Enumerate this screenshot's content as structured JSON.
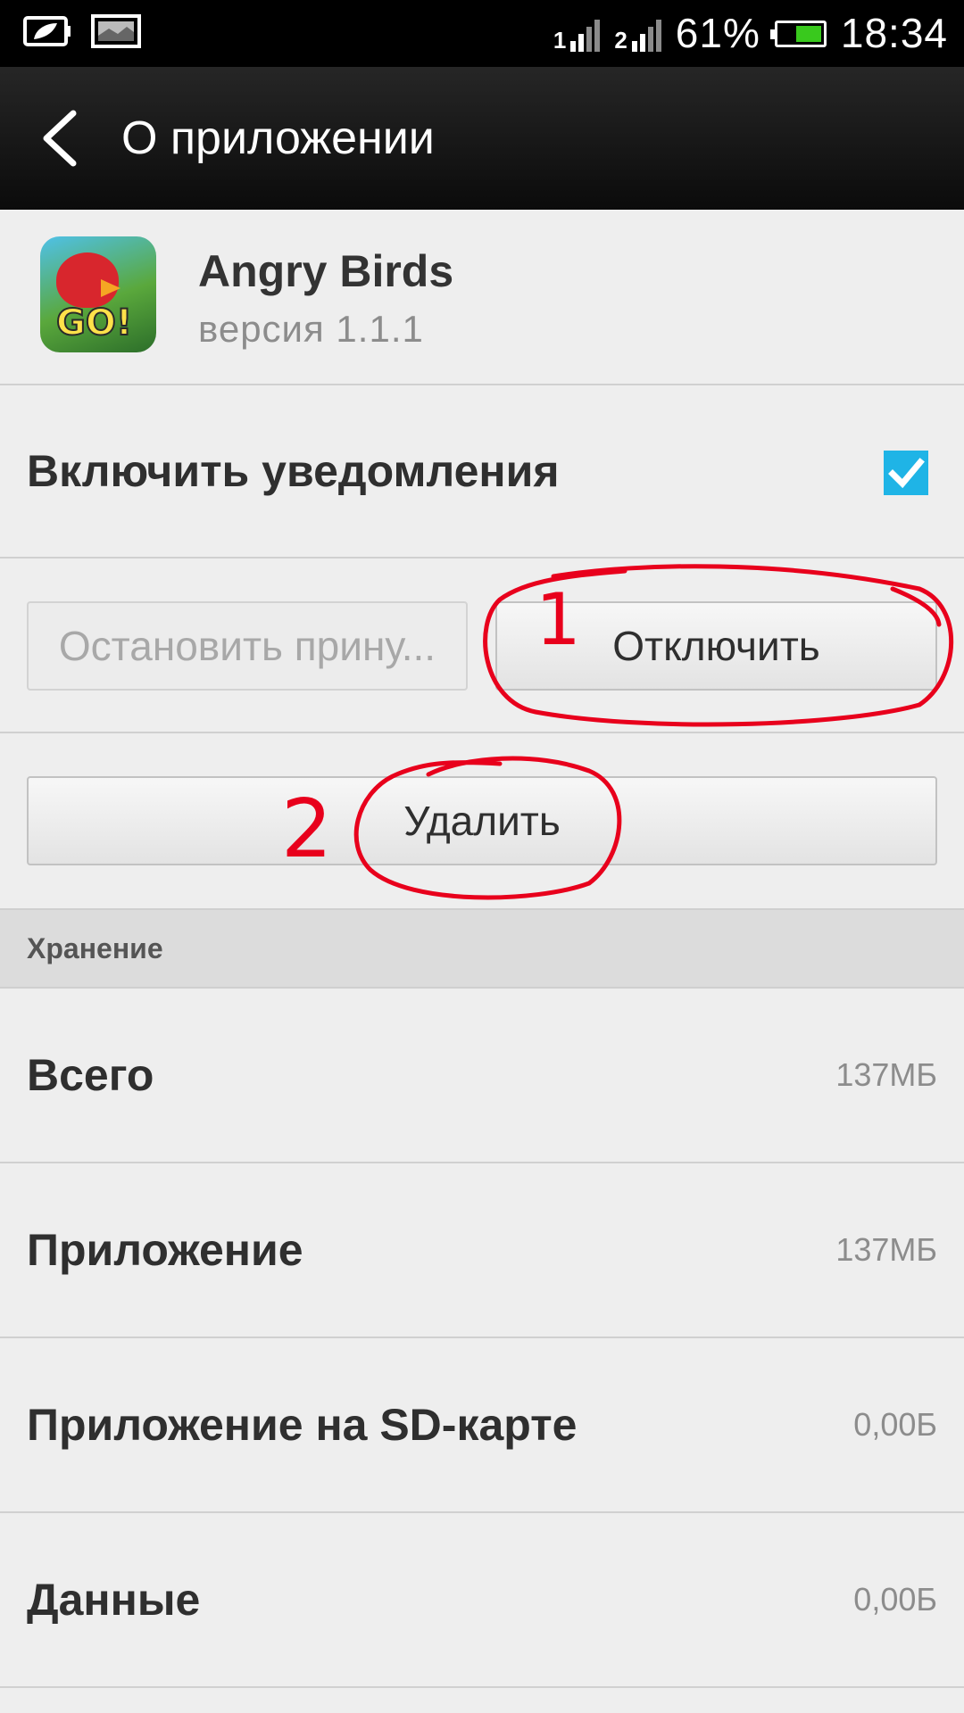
{
  "status_bar": {
    "signal1_label": "1",
    "signal2_label": "2",
    "battery_percent": "61%",
    "battery_level": 0.61,
    "time": "18:34"
  },
  "action_bar": {
    "title": "О приложении"
  },
  "app": {
    "name": "Angry Birds",
    "version": "версия 1.1.1",
    "icon_text": "GO!"
  },
  "notifications": {
    "label": "Включить уведомления",
    "checked": true
  },
  "buttons": {
    "force_stop": "Остановить прину...",
    "disable": "Отключить",
    "uninstall": "Удалить"
  },
  "annotations": {
    "mark1": "1",
    "mark2": "2",
    "color": "#e8001c"
  },
  "storage": {
    "section_title": "Хранение",
    "rows": [
      {
        "label": "Всего",
        "value": "137МБ"
      },
      {
        "label": "Приложение",
        "value": "137МБ"
      },
      {
        "label": "Приложение на SD-карте",
        "value": "0,00Б"
      },
      {
        "label": "Данные",
        "value": "0,00Б"
      }
    ]
  },
  "colors": {
    "accent": "#1fb4e6",
    "status_bar": "#000000",
    "action_bar": "#1a1a1a",
    "background": "#eeeeee"
  }
}
